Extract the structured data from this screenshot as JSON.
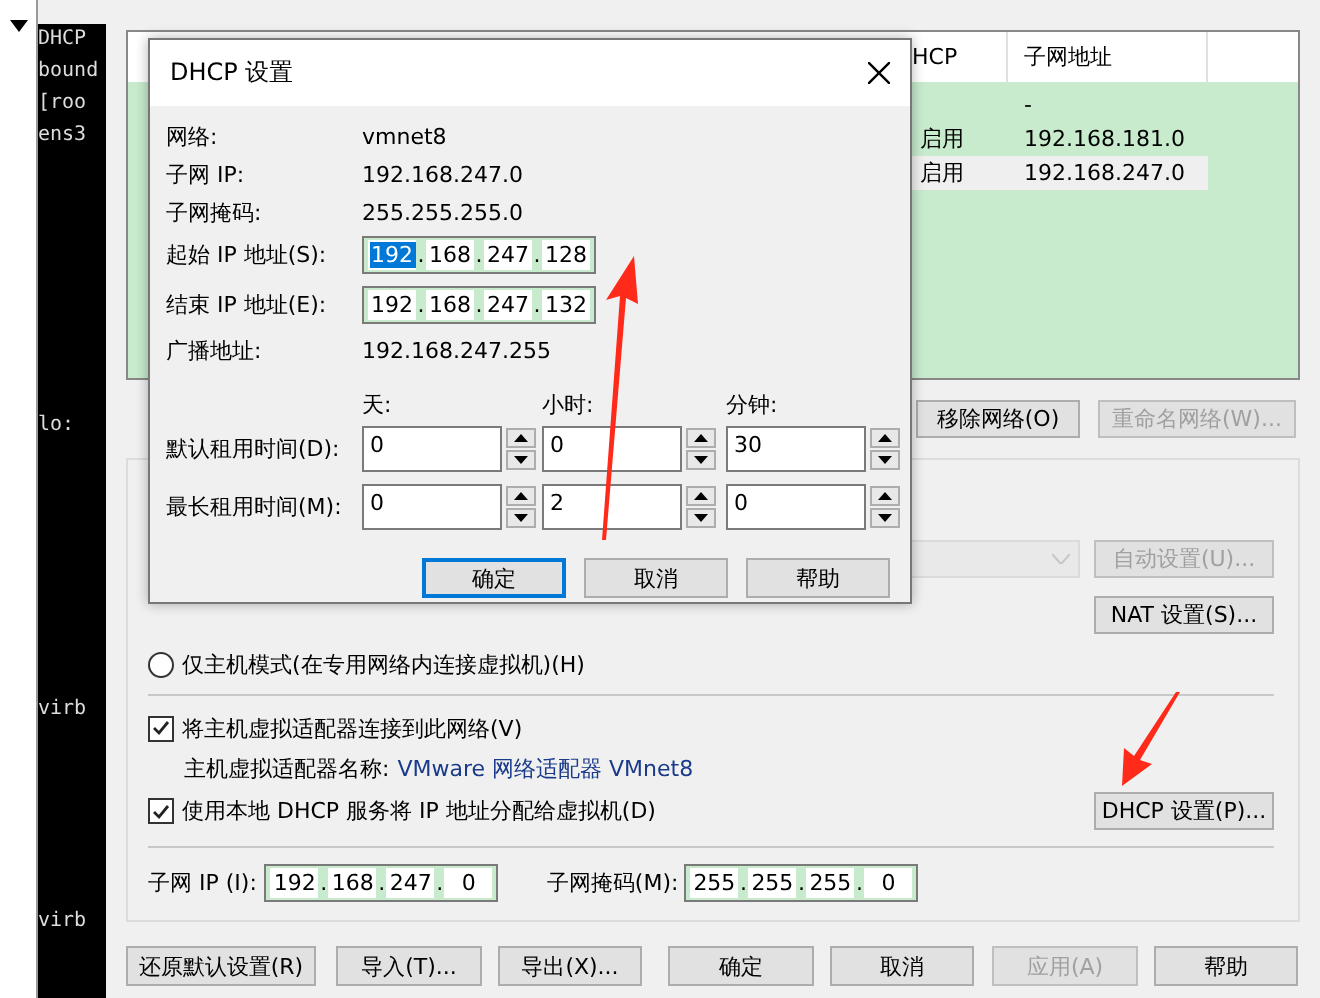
{
  "terminal": {
    "lines": [
      "DHCP",
      "bound",
      "[roo",
      "ens3",
      "lo:",
      "virb",
      "virb"
    ]
  },
  "table": {
    "columns": [
      {
        "label": "HCP"
      },
      {
        "label": "子网地址"
      }
    ],
    "rows": [
      {
        "subnet": "-",
        "selected": false
      },
      {
        "dhcp": "启用",
        "subnet": "192.168.181.0",
        "selected": false
      },
      {
        "dhcp": "启用",
        "subnet": "192.168.247.0",
        "selected": true
      }
    ]
  },
  "network_buttons": [
    {
      "label": "移除网络(O)",
      "disabled": false
    },
    {
      "label": "重命名网络(W)...",
      "disabled": true
    }
  ],
  "settings": {
    "dropdown": {
      "disabled": true
    },
    "auto_button": {
      "label": "自动设置(U)...",
      "disabled": true
    },
    "nat_button": {
      "label": "NAT 设置(S)...",
      "disabled": false
    },
    "host_only": {
      "label": "仅主机模式(在专用网络内连接虚拟机)(H)",
      "selected": false
    },
    "connect_adapter": {
      "label": "将主机虚拟适配器连接到此网络(V)",
      "checked": true
    },
    "adapter_name": {
      "label": "主机虚拟适配器名称:",
      "value": "VMware 网络适配器 VMnet8"
    },
    "use_dhcp": {
      "label": "使用本地 DHCP 服务将 IP 地址分配给虚拟机(D)",
      "checked": true
    },
    "dhcp_button": {
      "label": "DHCP 设置(P)...",
      "disabled": false
    },
    "subnet_ip": {
      "label": "子网 IP (I):",
      "separator": ".",
      "octets": [
        "192",
        "168",
        "247",
        "0"
      ]
    },
    "subnet_mask": {
      "label": "子网掩码(M):",
      "separator": ".",
      "octets": [
        "255",
        "255",
        "255",
        "0"
      ]
    }
  },
  "footer_buttons": [
    {
      "label": "还原默认设置(R)",
      "disabled": false
    },
    {
      "label": "导入(T)...",
      "disabled": false
    },
    {
      "label": "导出(X)...",
      "disabled": false
    },
    {
      "label": "确定",
      "disabled": false
    },
    {
      "label": "取消",
      "disabled": false
    },
    {
      "label": "应用(A)",
      "disabled": true
    },
    {
      "label": "帮助",
      "disabled": false
    }
  ],
  "dialog": {
    "title": "DHCP 设置",
    "info": [
      {
        "label": "网络:",
        "value": "vmnet8"
      },
      {
        "label": "子网 IP:",
        "value": "192.168.247.0"
      },
      {
        "label": "子网掩码:",
        "value": "255.255.255.0"
      }
    ],
    "ranges": [
      {
        "label": "起始 IP 地址(S):",
        "separator": ".",
        "octets": [
          {
            "value": "192",
            "selected": true
          },
          {
            "value": "168",
            "selected": false
          },
          {
            "value": "247",
            "selected": false
          },
          {
            "value": "128",
            "selected": false
          }
        ]
      },
      {
        "label": "结束 IP 地址(E):",
        "separator": ".",
        "octets": [
          {
            "value": "192",
            "selected": false
          },
          {
            "value": "168",
            "selected": false
          },
          {
            "value": "247",
            "selected": false
          },
          {
            "value": "132",
            "selected": false
          }
        ]
      }
    ],
    "broadcast": {
      "label": "广播地址:",
      "value": "192.168.247.255"
    },
    "lease_columns": [
      "天:",
      "小时:",
      "分钟:"
    ],
    "leases": [
      {
        "label": "默认租用时间(D):",
        "values": [
          "0",
          "0",
          "30"
        ]
      },
      {
        "label": "最长租用时间(M):",
        "values": [
          "0",
          "2",
          "0"
        ]
      }
    ],
    "buttons": [
      {
        "label": "确定",
        "focused": true
      },
      {
        "label": "取消",
        "focused": false
      },
      {
        "label": "帮助",
        "focused": false
      }
    ]
  }
}
